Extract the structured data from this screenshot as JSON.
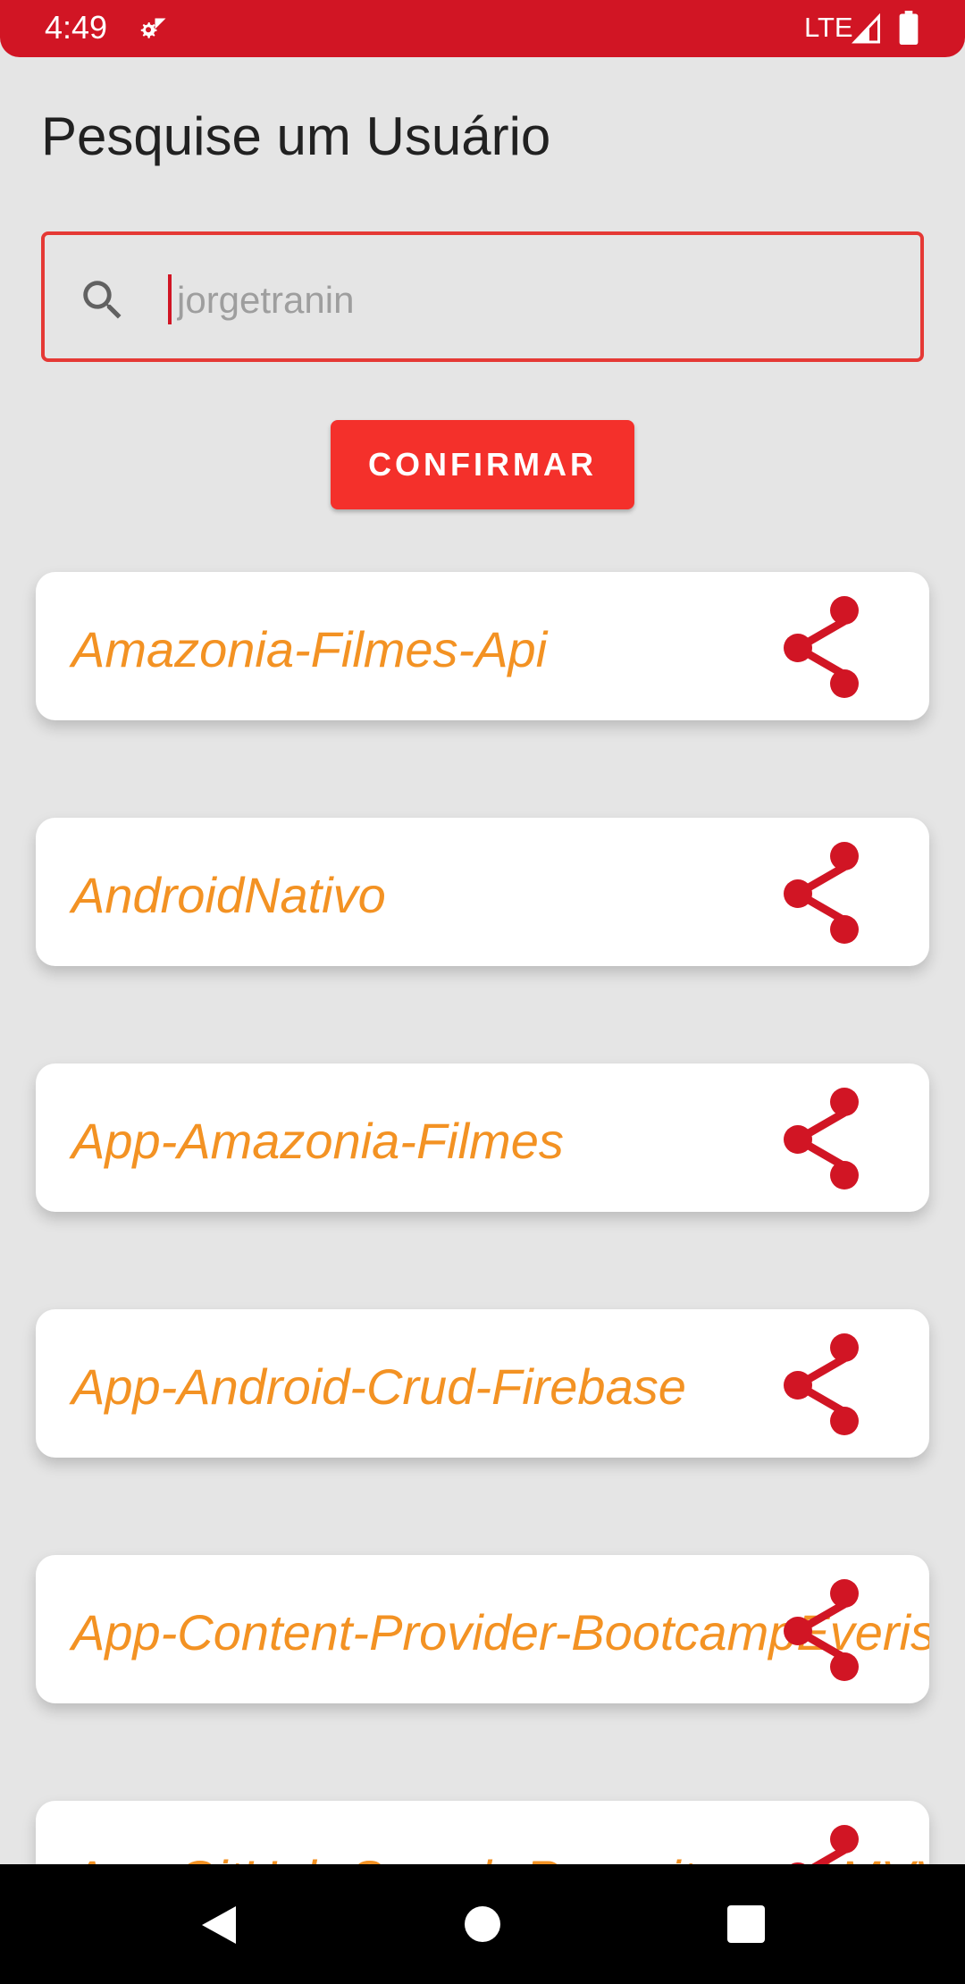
{
  "status_bar": {
    "time": "4:49",
    "network": "LTE"
  },
  "header": {
    "title": "Pesquise um Usuário"
  },
  "search": {
    "placeholder": "jorgetranin",
    "value": ""
  },
  "confirm": {
    "label": "CONFIRMAR"
  },
  "repositories": [
    {
      "name": "Amazonia-Filmes-Api",
      "icon": "share-icon"
    },
    {
      "name": "AndroidNativo",
      "icon": "share-icon"
    },
    {
      "name": "App-Amazonia-Filmes",
      "icon": "share-icon"
    },
    {
      "name": "App-Android-Crud-Firebase",
      "icon": "share-icon"
    },
    {
      "name": "App-Content-Provider-BootcampEveris",
      "icon": "share-icon"
    },
    {
      "name": "App-GitHub-Search-Repositorys-AMVV",
      "icon": "share-icon"
    }
  ],
  "colors": {
    "status_bar": "#d11524",
    "accent": "#f4302b",
    "repo_text": "#f39223",
    "share_icon": "#d11524",
    "background": "#e5e5e5"
  }
}
